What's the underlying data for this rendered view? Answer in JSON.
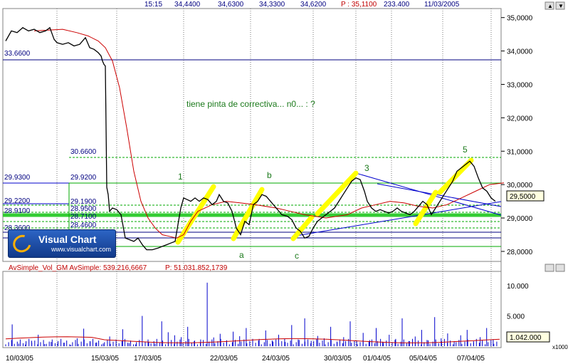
{
  "header": {
    "time": "15:15",
    "open": "34,4400",
    "high": "34,6300",
    "low": "34,3300",
    "close": "34,6200",
    "last_label": "P : 35,1100",
    "volume": "233.400",
    "date": "11/03/2005"
  },
  "volume_header": {
    "label": "AvSimple_Vol_GM AvSimple:",
    "value1": "539.216,6667",
    "p_label": "P: 51.031.852,1739"
  },
  "logo": {
    "title": "Visual Chart",
    "url": "www.visualchart.com"
  },
  "annotation": "tiene pinta de correctiva... n0... : ?",
  "price_box": "29,5000",
  "volume_box": "1.042.000",
  "volume_unit": "x1000",
  "colors": {
    "price": "#000000",
    "ma": "#cc0000",
    "volume": "#0000cc",
    "highlight": "#ffff00",
    "level": "#00aa00",
    "trend": "#0000cc"
  },
  "chart_data": [
    {
      "type": "line",
      "name": "price",
      "x_tick_labels": [
        "10/03/05",
        "15/03/05",
        "17/03/05",
        "22/03/05",
        "24/03/05",
        "30/03/05",
        "01/04/05",
        "05/04/05",
        "07/04/05"
      ],
      "y_tick_labels": [
        "28,0000",
        "29,0000",
        "30,0000",
        "31,0000",
        "32,0000",
        "33,0000",
        "34,0000",
        "35,0000"
      ],
      "ylim": [
        27.7,
        35.1
      ],
      "x": [
        0,
        8,
        16,
        24,
        32,
        40,
        48,
        56,
        62,
        68,
        72,
        80,
        88,
        96,
        104,
        112,
        118,
        124,
        130,
        134,
        136,
        138,
        140,
        142,
        144,
        146,
        150,
        156,
        162,
        168,
        174,
        180,
        186,
        192,
        198,
        206,
        214,
        220,
        226,
        232,
        238,
        242,
        246,
        250,
        255,
        260,
        266,
        272,
        278,
        284,
        290,
        296,
        300,
        306,
        312,
        318,
        324,
        330,
        336,
        342,
        348,
        354,
        360,
        366,
        372,
        380,
        388,
        396,
        402,
        408,
        414,
        420,
        426,
        432,
        438,
        444,
        450,
        456,
        462,
        468,
        474,
        480,
        486,
        492,
        498,
        504,
        508,
        514,
        520,
        526,
        532,
        538,
        544,
        550,
        556,
        562,
        568,
        574,
        580,
        586,
        592,
        598,
        604,
        610,
        616,
        622,
        628,
        634,
        640,
        646,
        652,
        658,
        664,
        670,
        676,
        682,
        688,
        694
      ],
      "y": [
        34.3,
        34.6,
        34.55,
        34.7,
        34.6,
        34.65,
        34.55,
        34.6,
        34.7,
        34.35,
        34.25,
        34.2,
        34.25,
        34.15,
        34.2,
        34.4,
        34.1,
        34.05,
        33.95,
        33.85,
        33.7,
        33.6,
        33.55,
        29.92,
        29.7,
        29.2,
        29.3,
        29.25,
        29.1,
        28.4,
        28.35,
        28.3,
        28.4,
        28.2,
        28.05,
        28.05,
        28.1,
        28.15,
        28.2,
        28.25,
        28.3,
        28.8,
        29.3,
        29.6,
        29.55,
        29.5,
        29.6,
        29.5,
        29.6,
        29.55,
        29.4,
        29.5,
        29.7,
        29.5,
        29.45,
        29.2,
        28.7,
        28.5,
        28.9,
        28.8,
        29.4,
        29.5,
        29.7,
        29.65,
        29.5,
        29.3,
        29.1,
        29.05,
        28.95,
        28.7,
        28.6,
        28.4,
        28.45,
        28.7,
        28.9,
        29.0,
        29.1,
        29.2,
        29.3,
        29.5,
        29.7,
        29.9,
        30.1,
        30.2,
        30.15,
        29.8,
        29.5,
        29.3,
        29.2,
        29.25,
        29.2,
        29.15,
        29.2,
        29.3,
        29.2,
        29.15,
        29.1,
        29.2,
        29.35,
        29.5,
        29.4,
        29.1,
        29.3,
        29.5,
        29.7,
        29.9,
        30.1,
        30.4,
        30.5,
        30.6,
        30.7,
        30.55,
        30.2,
        29.9,
        29.8,
        29.6,
        29.5
      ]
    },
    {
      "type": "line",
      "name": "moving-average",
      "x": [
        40,
        80,
        100,
        116,
        130,
        140,
        150,
        160,
        170,
        180,
        190,
        200,
        210,
        220,
        230,
        240,
        250,
        260,
        270,
        290,
        310,
        330,
        350,
        380,
        400,
        420,
        450,
        480,
        500,
        520,
        540,
        560,
        580,
        600,
        620,
        640,
        660,
        680,
        700
      ],
      "y": [
        34.6,
        34.65,
        34.55,
        34.45,
        34.3,
        34.1,
        33.7,
        32.9,
        31.7,
        30.4,
        29.5,
        29.0,
        28.7,
        28.5,
        28.45,
        28.4,
        28.5,
        28.9,
        29.2,
        29.4,
        29.5,
        29.45,
        29.4,
        29.3,
        29.2,
        29.1,
        29.0,
        29.1,
        29.3,
        29.4,
        29.5,
        29.45,
        29.35,
        29.3,
        29.4,
        29.6,
        29.8,
        30.0,
        30.05
      ]
    },
    {
      "type": "bar",
      "name": "volume",
      "ylim": [
        0,
        12000
      ],
      "y_tick_labels": [
        "5.000",
        "10.000"
      ],
      "baseline_bars": 170,
      "values": [
        120,
        3600,
        420,
        260,
        900,
        1900,
        350,
        700,
        450,
        580,
        240,
        1300,
        2900,
        780,
        620,
        460,
        1600,
        380,
        2800,
        520,
        310,
        5000,
        650,
        410,
        4100,
        2300,
        1800,
        1500,
        3200,
        820,
        1100,
        10500,
        1450,
        2050,
        980,
        2400,
        1650,
        3000,
        760,
        1200,
        2600,
        930,
        1900,
        700,
        3500,
        1100,
        4600,
        880,
        1700,
        1300,
        3200,
        640,
        1500,
        4100,
        900,
        2200,
        1000,
        3000,
        740,
        1900,
        1200,
        4600,
        850,
        1600,
        2700,
        960,
        4800,
        1300,
        2100,
        830,
        1800,
        2700,
        600,
        1500,
        3000,
        1150
      ]
    }
  ]
}
